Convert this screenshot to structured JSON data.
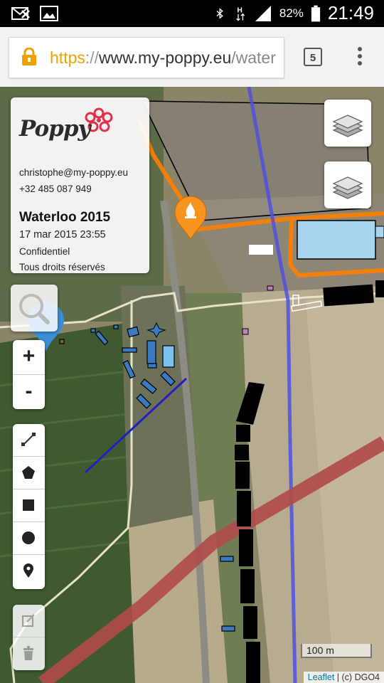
{
  "status_bar": {
    "battery": "82%",
    "time": "21:49",
    "icons": [
      "notifications-off-icon",
      "image-icon",
      "bluetooth-icon",
      "hsdpa-icon",
      "signal-icon",
      "battery-icon"
    ]
  },
  "browser": {
    "url_scheme": "https",
    "url_sep": "://",
    "url_host": "www.my-poppy.eu",
    "url_path": "/water",
    "tab_count": "5",
    "colors": {
      "https": "#f0a000",
      "lock": "#f0a000"
    }
  },
  "info_panel": {
    "logo_text": "Poppy",
    "email": "christophe@my-poppy.eu",
    "phone": "+32 485 087 949",
    "title": "Waterloo 2015",
    "date": "17 mar 2015 23:55",
    "confidential": "Confidentiel",
    "rights": "Tous droits réservés"
  },
  "map": {
    "scale_label": "100 m",
    "attribution_link": "Leaflet",
    "attribution_rest": "| (c) DGO4",
    "zoom_in_label": "+",
    "zoom_out_label": "-",
    "colors": {
      "route_orange": "#ff8000",
      "line_blue": "#5050e0",
      "line_red": "#b04a4a",
      "fill_lightblue": "#a8d4f0",
      "marker_orange": "#f7941d"
    },
    "draw_tools": [
      "polyline-icon",
      "polygon-icon",
      "rectangle-icon",
      "circle-icon",
      "marker-icon"
    ],
    "edit_tools": [
      "edit-icon",
      "delete-icon"
    ]
  }
}
